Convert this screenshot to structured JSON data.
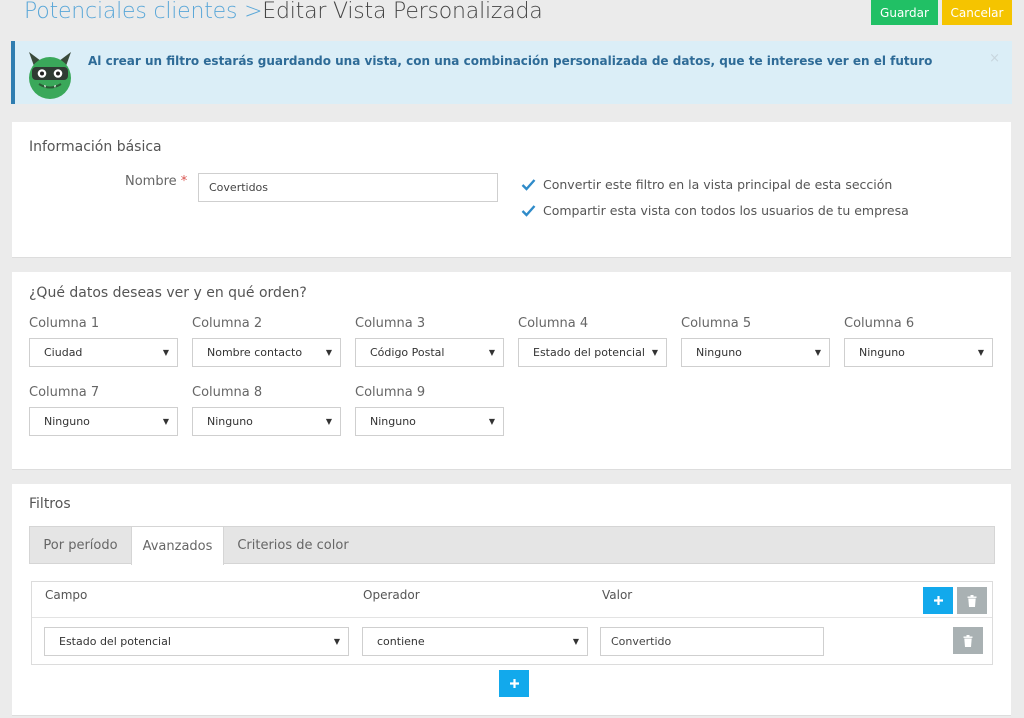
{
  "header": {
    "breadcrumb_parent": "Potenciales clientes",
    "separator": ">",
    "title": "Editar Vista Personalizada",
    "save_label": "Guardar",
    "cancel_label": "Cancelar"
  },
  "alert": {
    "message": "Al crear un filtro estarás guardando una vista, con una combinación personalizada de datos, que te interese ver en el futuro",
    "close_symbol": "×"
  },
  "basic": {
    "title": "Información básica",
    "name_label": "Nombre",
    "required_mark": "*",
    "name_value": "Covertidos",
    "option_main_view": "Convertir este filtro en la vista principal de esta sección",
    "option_share": "Compartir esta vista con todos los usuarios de tu empresa",
    "main_view_checked": true,
    "share_checked": true
  },
  "columns": {
    "title": "¿Qué datos deseas ver y en qué orden?",
    "items": [
      {
        "label": "Columna 1",
        "value": "Ciudad"
      },
      {
        "label": "Columna 2",
        "value": "Nombre contacto"
      },
      {
        "label": "Columna 3",
        "value": "Código Postal"
      },
      {
        "label": "Columna 4",
        "value": "Estado del potencial"
      },
      {
        "label": "Columna 5",
        "value": "Ninguno"
      },
      {
        "label": "Columna 6",
        "value": "Ninguno"
      },
      {
        "label": "Columna 7",
        "value": "Ninguno"
      },
      {
        "label": "Columna 8",
        "value": "Ninguno"
      },
      {
        "label": "Columna 9",
        "value": "Ninguno"
      }
    ]
  },
  "filters": {
    "title": "Filtros",
    "tabs": [
      {
        "label": "Por período",
        "active": false
      },
      {
        "label": "Avanzados",
        "active": true
      },
      {
        "label": "Criterios de color",
        "active": false
      }
    ],
    "headers": {
      "field": "Campo",
      "operator": "Operador",
      "value": "Valor"
    },
    "rows": [
      {
        "field": "Estado del potencial",
        "operator": "contiene",
        "value": "Convertido"
      }
    ]
  },
  "icons": {
    "caret": "caret-down-icon",
    "add": "plus-icon",
    "delete": "trash-icon",
    "check": "check-icon",
    "mascot": "monster-mascot"
  },
  "colors": {
    "primary_link": "#5aa7d8",
    "save": "#21c065",
    "cancel": "#f5c400",
    "alert_bg": "#dbeef7",
    "alert_text": "#2e6b97",
    "add_button": "#12a9ec",
    "delete_button": "#a9b1b3",
    "check": "#2f8bc9"
  }
}
